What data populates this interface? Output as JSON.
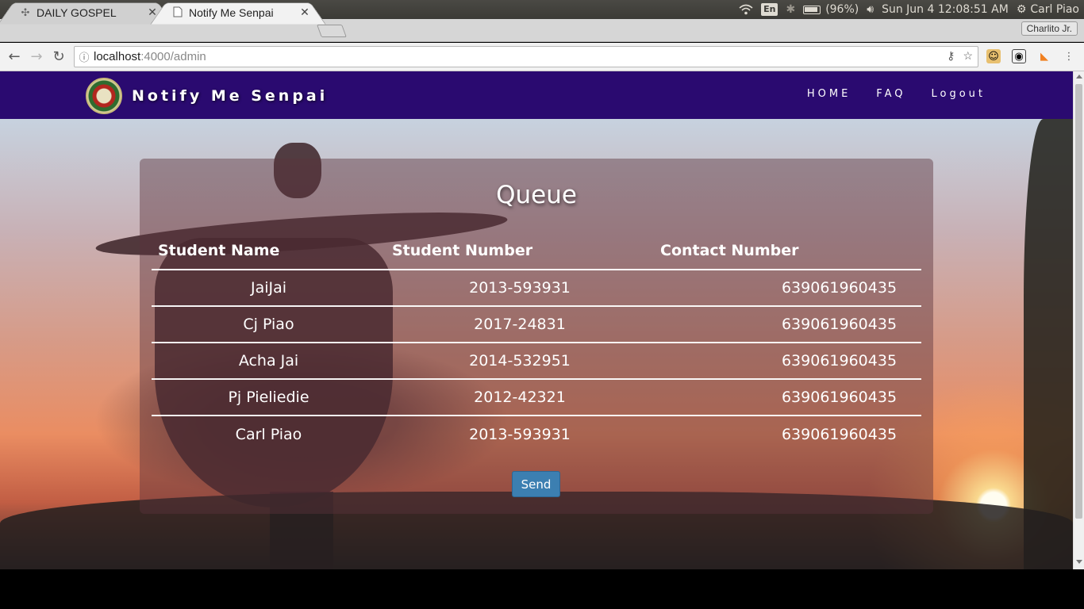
{
  "os_panel": {
    "lang": "En",
    "battery": "(96%)",
    "datetime": "Sun Jun  4 12:08:51 AM",
    "user": "Carl Piao"
  },
  "browser": {
    "tabs": [
      {
        "title": "DAILY GOSPEL",
        "active": false
      },
      {
        "title": "Notify Me Senpai",
        "active": true
      }
    ],
    "profile": "Charlito Jr.",
    "url_host": "localhost",
    "url_path": ":4000/admin"
  },
  "navbar": {
    "brand": "Notify Me Senpai",
    "links": [
      "HOME",
      "FAQ",
      "Logout"
    ]
  },
  "queue": {
    "title": "Queue",
    "headers": [
      "Student Name",
      "Student Number",
      "Contact Number"
    ],
    "rows": [
      [
        "JaiJai",
        "2013-593931",
        "639061960435"
      ],
      [
        "Cj Piao",
        "2017-24831",
        "639061960435"
      ],
      [
        "Acha Jai",
        "2014-532951",
        "639061960435"
      ],
      [
        "Pj Pieliedie",
        "2012-42321",
        "639061960435"
      ],
      [
        "Carl Piao",
        "2013-593931",
        "639061960435"
      ]
    ],
    "send_label": "Send"
  }
}
